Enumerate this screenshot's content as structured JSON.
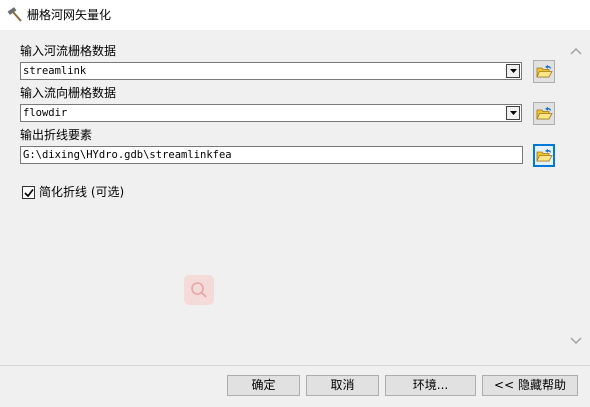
{
  "window": {
    "title": "栅格河网矢量化",
    "icon": "hammer-icon"
  },
  "form": {
    "stream_raster": {
      "label": "输入河流栅格数据",
      "value": "streamlink"
    },
    "flowdir_raster": {
      "label": "输入流向栅格数据",
      "value": "flowdir"
    },
    "output_features": {
      "label": "输出折线要素",
      "value": "G:\\dixing\\HYdro.gdb\\streamlinkfea"
    },
    "simplify": {
      "label": "简化折线 (可选)",
      "checked": true
    }
  },
  "buttons": {
    "ok": "确定",
    "cancel": "取消",
    "environments": "环境...",
    "hide_help": "<< 隐藏帮助"
  },
  "colors": {
    "focus_border": "#0078d7",
    "folder_yellow": "#f4c430"
  }
}
